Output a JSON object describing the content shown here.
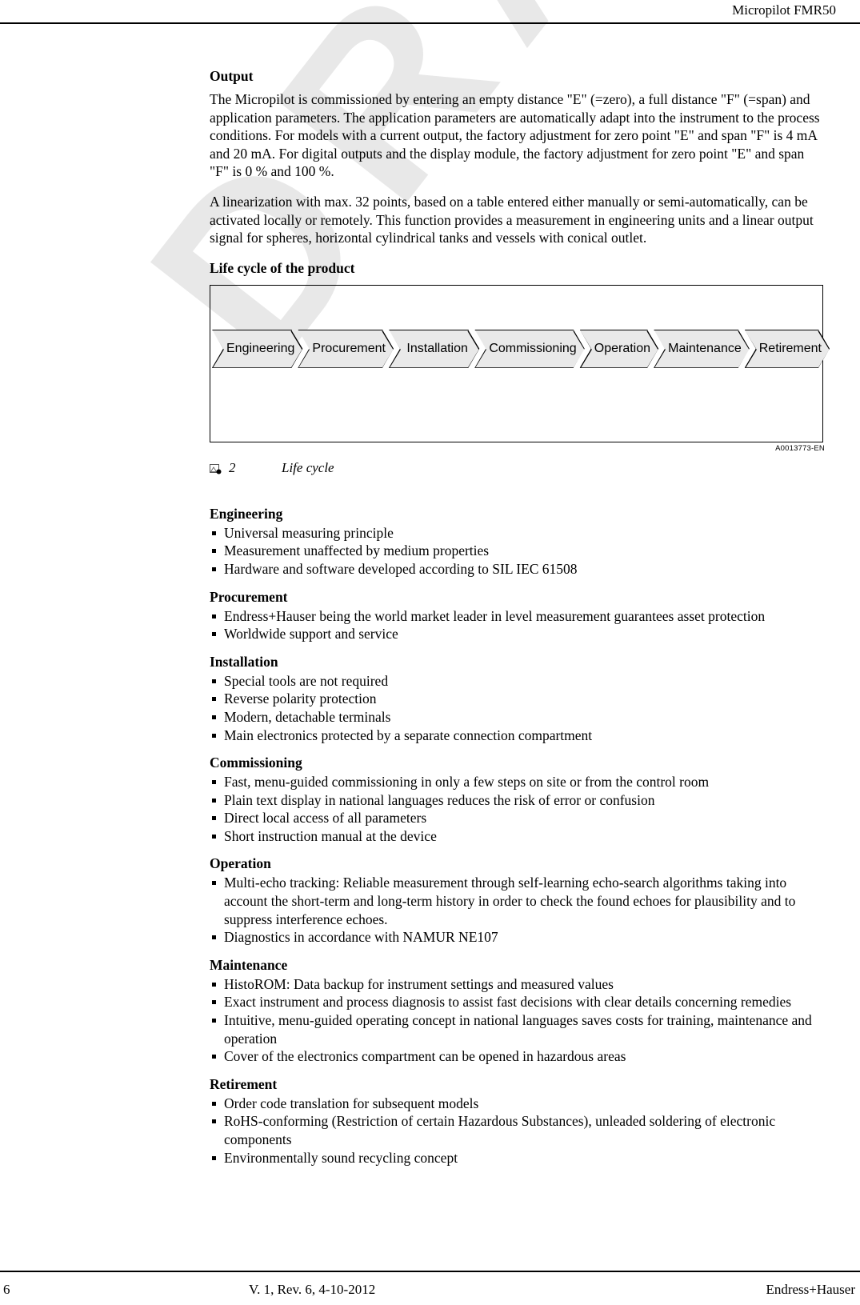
{
  "header": {
    "title": "Micropilot FMR50"
  },
  "footer": {
    "page_number": "6",
    "version": "V. 1, Rev. 6, 4-10-2012",
    "company": "Endress+Hauser"
  },
  "watermark": {
    "text": "DRAFT"
  },
  "content": {
    "output_heading": "Output",
    "output_paragraph_1": "The Micropilot is commissioned by entering an empty distance \"E\" (=zero), a full distance \"F\" (=span) and application parameters. The application parameters are automatically adapt into the instrument to the process conditions. For models with a current output, the factory adjustment for zero point \"E\" and span \"F\" is 4 mA and 20 mA. For digital outputs and the display module, the factory adjustment for zero point \"E\" and span \"F\" is 0 % and 100 %.",
    "output_paragraph_2": "A linearization with max. 32 points, based on a table entered either manually or semi-automatically, can be activated locally or remotely. This function provides a measurement in engineering units and a linear output signal for spheres, horizontal cylindrical tanks and vessels with conical outlet.",
    "lifecycle_heading": "Life cycle of the product"
  },
  "figure": {
    "graphic_id": "A0013773-EN",
    "number": "2",
    "caption": "Life cycle",
    "stages": [
      {
        "label": "Engineering"
      },
      {
        "label": "Procurement"
      },
      {
        "label": "Installation"
      },
      {
        "label": "Commissioning"
      },
      {
        "label": "Operation"
      },
      {
        "label": "Maintenance"
      },
      {
        "label": "Retirement"
      }
    ]
  },
  "sections": [
    {
      "heading": "Engineering",
      "items": [
        "Universal measuring principle",
        "Measurement unaffected by medium properties",
        "Hardware and software developed according to SIL IEC 61508"
      ]
    },
    {
      "heading": "Procurement",
      "items": [
        "Endress+Hauser being the world market leader in level measurement guarantees asset protection",
        "Worldwide support and service"
      ]
    },
    {
      "heading": "Installation",
      "items": [
        "Special tools are not required",
        "Reverse polarity protection",
        "Modern, detachable terminals",
        "Main electronics protected by a separate connection compartment"
      ]
    },
    {
      "heading": "Commissioning",
      "items": [
        "Fast, menu-guided commissioning in only a few steps on site or from the control room",
        "Plain text display in national languages reduces the risk of error or confusion",
        "Direct local access of all parameters",
        "Short instruction manual at the device"
      ]
    },
    {
      "heading": "Operation",
      "items": [
        "Multi-echo tracking: Reliable measurement through self-learning echo-search algorithms taking into account the short-term and long-term history in order to check the found echoes for plausibility and to suppress interference echoes.",
        "Diagnostics in accordance with NAMUR NE107"
      ]
    },
    {
      "heading": "Maintenance",
      "items": [
        "HistoROM: Data backup for instrument settings and measured values",
        "Exact instrument and process diagnosis to assist fast decisions with clear details concerning remedies",
        "Intuitive, menu-guided operating concept in national languages saves costs for training, maintenance and operation",
        "Cover of the electronics compartment can be opened in hazardous areas"
      ]
    },
    {
      "heading": "Retirement",
      "items": [
        "Order code translation for subsequent models",
        "RoHS-conforming (Restriction of certain Hazardous Substances), unleaded soldering of electronic components",
        "Environmentally sound recycling concept"
      ]
    }
  ]
}
